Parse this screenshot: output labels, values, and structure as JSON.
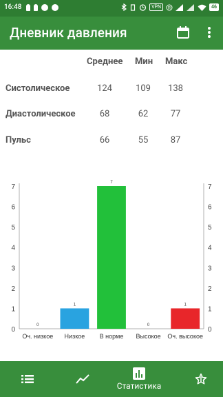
{
  "status_bar": {
    "time": "16:48",
    "vpn": "VPN",
    "battery": "46"
  },
  "app_bar": {
    "title": "Дневник давления"
  },
  "stats": {
    "headers": {
      "avg": "Среднее",
      "min": "Мин",
      "max": "Макс"
    },
    "rows": [
      {
        "label": "Систолическое",
        "avg": "124",
        "min": "109",
        "max": "138"
      },
      {
        "label": "Диастолическое",
        "avg": "68",
        "min": "62",
        "max": "77"
      },
      {
        "label": "Пульс",
        "avg": "66",
        "min": "55",
        "max": "87"
      }
    ]
  },
  "chart_data": {
    "type": "bar",
    "categories": [
      "Оч. низкое",
      "Низкое",
      "В норме",
      "Высокое",
      "Оч. высокое"
    ],
    "values": [
      0,
      1,
      7,
      0,
      1
    ],
    "colors": [
      "#9e9e9e",
      "#29a3e0",
      "#22c03a",
      "#9e9e9e",
      "#e8262a"
    ],
    "ylim": [
      0,
      7
    ],
    "yticks": [
      0,
      1,
      2,
      3,
      4,
      5,
      6,
      7
    ],
    "grid": false,
    "dual_axis": true
  },
  "bottom_nav": {
    "items": [
      {
        "icon": "list-icon",
        "label": ""
      },
      {
        "icon": "trend-icon",
        "label": ""
      },
      {
        "icon": "bar-chart-icon",
        "label": "Статистика"
      },
      {
        "icon": "star-icon",
        "label": ""
      }
    ]
  }
}
